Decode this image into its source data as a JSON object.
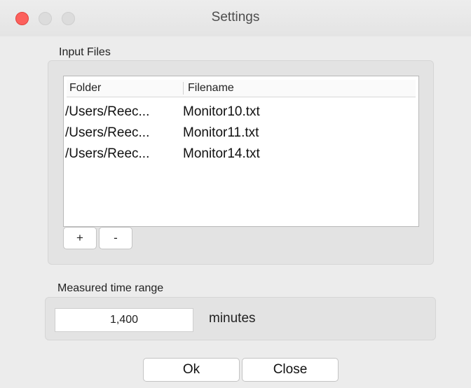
{
  "window": {
    "title": "Settings"
  },
  "input_files": {
    "label": "Input Files",
    "columns": [
      "Folder",
      "Filename"
    ],
    "rows": [
      {
        "folder": "/Users/Reec...",
        "filename": "Monitor10.txt"
      },
      {
        "folder": "/Users/Reec...",
        "filename": "Monitor11.txt"
      },
      {
        "folder": "/Users/Reec...",
        "filename": "Monitor14.txt"
      }
    ],
    "add_label": "+",
    "remove_label": "-"
  },
  "time_range": {
    "label": "Measured time range",
    "value": "1,400",
    "unit": "minutes"
  },
  "buttons": {
    "ok_label": "Ok",
    "close_label": "Close"
  },
  "colors": {
    "close_button": "#fc605c",
    "inactive_button": "#dcdcdc",
    "background": "#ececec"
  }
}
